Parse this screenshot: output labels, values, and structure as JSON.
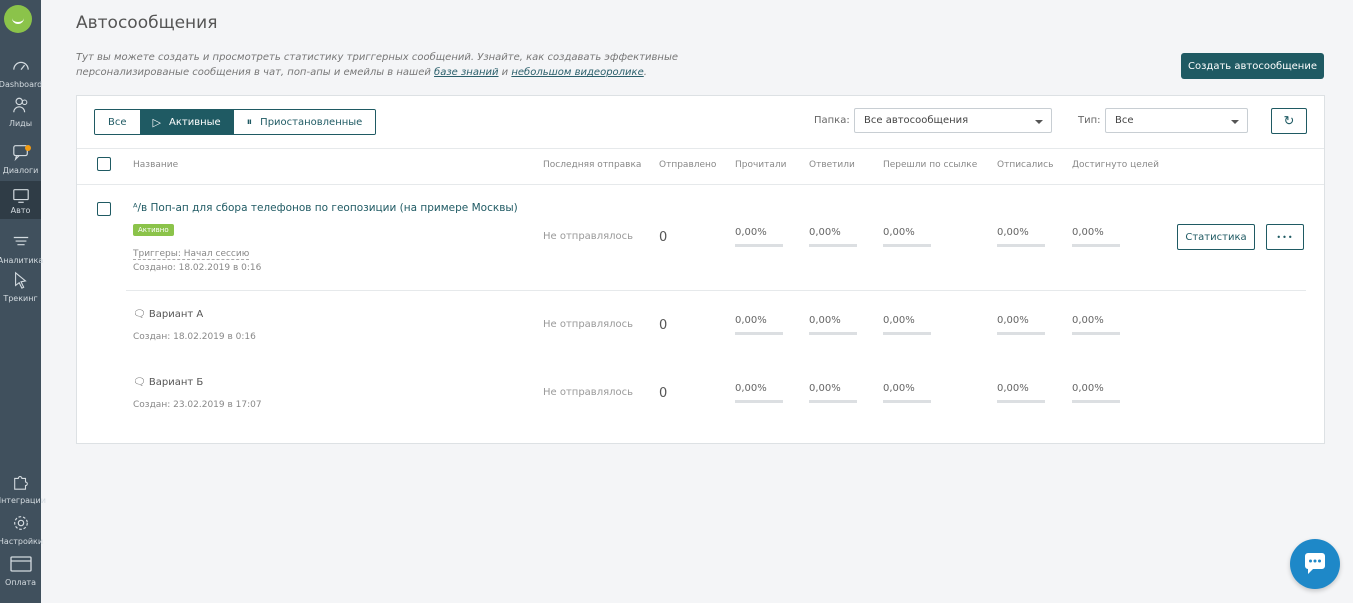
{
  "nav": {
    "dashboard": "Dashboard",
    "leads": "Лиды",
    "dialogs": "Диалоги",
    "auto": "Авто",
    "analytics": "Аналитика",
    "tracking": "Трекинг",
    "integrations": "Интеграции",
    "settings": "Настройки",
    "payment": "Оплата"
  },
  "page": {
    "title": "Автосообщения",
    "desc_part1": "Тут вы можете создать и просмотреть статистику триггерных сообщений. Узнайте, как создавать эффективные персонализированые сообщения в чат, поп-апы и емейлы в нашей ",
    "desc_link1": "базе знаний",
    "desc_mid": " и ",
    "desc_link2": "небольшом видеоролике",
    "desc_end": ".",
    "create_button": "Создать автосообщение"
  },
  "filters": {
    "tab_all": "Все",
    "tab_active": "Активные",
    "tab_paused": "Приостановленные",
    "folder_label": "Папка:",
    "folder_value": "Все автосообщения",
    "type_label": "Тип:",
    "type_value": "Все"
  },
  "columns": {
    "name": "Название",
    "last_sent": "Последняя отправка",
    "sent": "Отправлено",
    "read": "Прочитали",
    "replied": "Ответили",
    "clicked": "Перешли по ссылке",
    "unsubscribed": "Отписались",
    "goals": "Достигнуто целей"
  },
  "message": {
    "ab_prefix": "ᴬ/ʙ",
    "title": "Поп-ап для сбора телефонов по геопозиции (на примере Москвы)",
    "status": "Активно",
    "triggers": "Триггеры: Начал сессию",
    "created": "Создано: 18.02.2019 в 0:16",
    "last_sent": "Не отправлялось",
    "sent": "0",
    "read": "0,00%",
    "replied": "0,00%",
    "clicked": "0,00%",
    "unsubscribed": "0,00%",
    "goals": "0,00%",
    "stats_button": "Статистика",
    "more_button": "•••"
  },
  "variants": [
    {
      "name": "Вариант А",
      "created": "Создан: 18.02.2019 в 0:16",
      "last_sent": "Не отправлялось",
      "sent": "0",
      "read": "0,00%",
      "replied": "0,00%",
      "clicked": "0,00%",
      "unsubscribed": "0,00%",
      "goals": "0,00%"
    },
    {
      "name": "Вариант Б",
      "created": "Создан: 23.02.2019 в 17:07",
      "last_sent": "Не отправлялось",
      "sent": "0",
      "read": "0,00%",
      "replied": "0,00%",
      "clicked": "0,00%",
      "unsubscribed": "0,00%",
      "goals": "0,00%"
    }
  ],
  "colors": {
    "sidebar": "#40505d",
    "accent": "#1f5a63",
    "status_green": "#8bc34a",
    "chat_blue": "#1e88c8"
  }
}
